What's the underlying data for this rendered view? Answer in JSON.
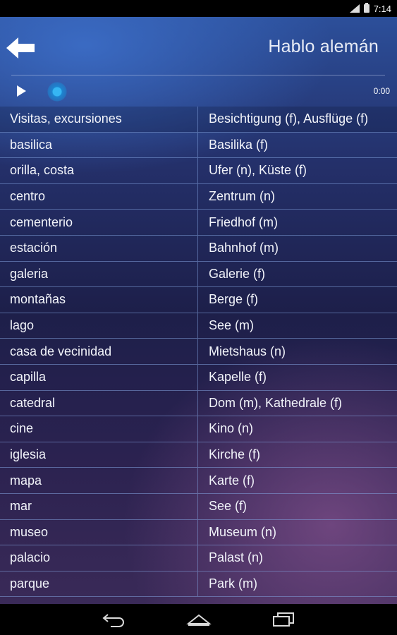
{
  "status_bar": {
    "time": "7:14"
  },
  "header": {
    "title": "Hablo alemán"
  },
  "player": {
    "time": "0:00"
  },
  "rows": [
    {
      "es": "Visitas, excursiones",
      "de": "Besichtigung (f), Ausflüge (f)"
    },
    {
      "es": "basilica",
      "de": "Basilika (f)"
    },
    {
      "es": "orilla, costa",
      "de": "Ufer (n), Küste (f)"
    },
    {
      "es": "centro",
      "de": "Zentrum (n)"
    },
    {
      "es": "cementerio",
      "de": "Friedhof (m)"
    },
    {
      "es": "estación",
      "de": "Bahnhof (m)"
    },
    {
      "es": "galeria",
      "de": "Galerie (f)"
    },
    {
      "es": "montañas",
      "de": "Berge (f)"
    },
    {
      "es": "lago",
      "de": "See (m)"
    },
    {
      "es": "casa de vecinidad",
      "de": "Mietshaus (n)"
    },
    {
      "es": "capilla",
      "de": "Kapelle (f)"
    },
    {
      "es": "catedral",
      "de": "Dom (m), Kathedrale (f)"
    },
    {
      "es": "cine",
      "de": "Kino (n)"
    },
    {
      "es": "iglesia",
      "de": "Kirche (f)"
    },
    {
      "es": "mapa",
      "de": "Karte (f)"
    },
    {
      "es": "mar",
      "de": "See (f)"
    },
    {
      "es": "museo",
      "de": "Museum (n)"
    },
    {
      "es": "palacio",
      "de": "Palast (n)"
    },
    {
      "es": "parque",
      "de": "Park (m)"
    }
  ],
  "icons": {
    "back": "arrow-left-icon",
    "play": "play-icon",
    "nav_back": "back-icon",
    "nav_home": "home-icon",
    "nav_recents": "recents-icon"
  },
  "colors": {
    "accent": "#1d85d0",
    "text": "#f2f4fa"
  }
}
